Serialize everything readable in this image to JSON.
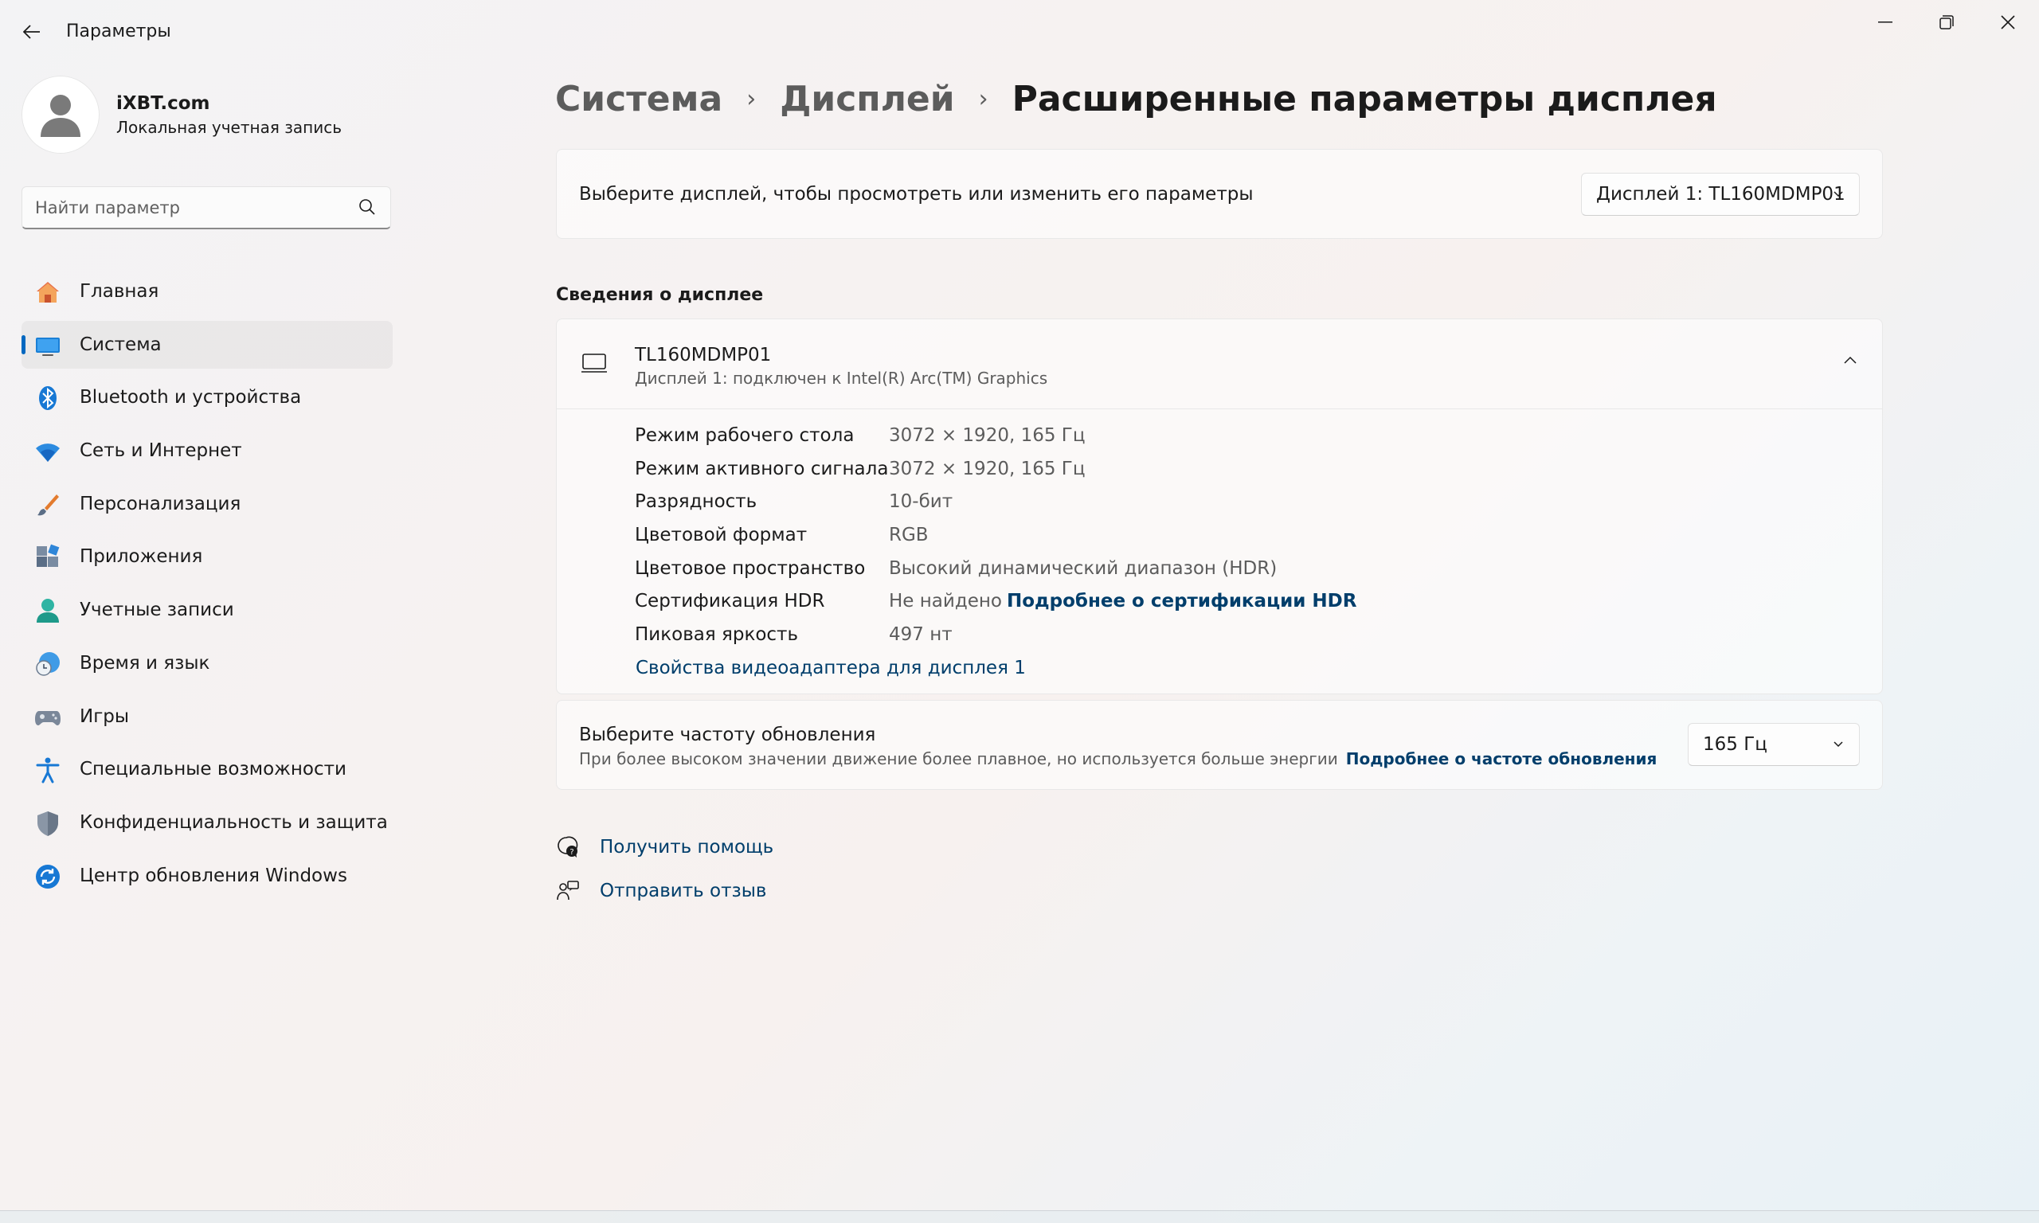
{
  "app": {
    "title": "Параметры"
  },
  "profile": {
    "name": "iXBT.com",
    "subtitle": "Локальная учетная запись"
  },
  "search": {
    "placeholder": "Найти параметр"
  },
  "sidebar": {
    "items": [
      {
        "label": "Главная",
        "icon": "home-icon"
      },
      {
        "label": "Система",
        "icon": "system-icon",
        "active": true
      },
      {
        "label": "Bluetooth и устройства",
        "icon": "bluetooth-icon"
      },
      {
        "label": "Сеть и Интернет",
        "icon": "wifi-icon"
      },
      {
        "label": "Персонализация",
        "icon": "brush-icon"
      },
      {
        "label": "Приложения",
        "icon": "apps-icon"
      },
      {
        "label": "Учетные записи",
        "icon": "accounts-icon"
      },
      {
        "label": "Время и язык",
        "icon": "time-language-icon"
      },
      {
        "label": "Игры",
        "icon": "gamepad-icon"
      },
      {
        "label": "Специальные возможности",
        "icon": "accessibility-icon"
      },
      {
        "label": "Конфиденциальность и защита",
        "icon": "shield-icon"
      },
      {
        "label": "Центр обновления Windows",
        "icon": "windows-update-icon"
      }
    ]
  },
  "breadcrumb": {
    "items": [
      "Система",
      "Дисплей"
    ],
    "current": "Расширенные параметры дисплея"
  },
  "display_select": {
    "label": "Выберите дисплей, чтобы просмотреть или изменить его параметры",
    "value": "Дисплей 1: TL160MDMP01"
  },
  "display_info": {
    "section_title": "Сведения о дисплее",
    "name": "TL160MDMP01",
    "subtitle": "Дисплей 1: подключен к Intel(R) Arc(TM) Graphics",
    "rows": [
      {
        "key": "Режим рабочего стола",
        "value": "3072 × 1920, 165 Гц"
      },
      {
        "key": "Режим активного сигнала",
        "value": "3072 × 1920, 165 Гц"
      },
      {
        "key": "Разрядность",
        "value": "10-бит"
      },
      {
        "key": "Цветовой формат",
        "value": "RGB"
      },
      {
        "key": "Цветовое пространство",
        "value": "Высокий динамический диапазон (HDR)"
      },
      {
        "key": "Сертификация HDR",
        "value": "Не найдено",
        "link": "Подробнее о сертификации HDR"
      },
      {
        "key": "Пиковая яркость",
        "value": "497 нт"
      }
    ],
    "adapter_link": "Свойства видеоадаптера для дисплея 1"
  },
  "refresh_rate": {
    "title": "Выберите частоту обновления",
    "subtitle": "При более высоком значении движение более плавное, но используется больше энергии",
    "link": "Подробнее о частоте обновления",
    "value": "165 Гц"
  },
  "help": {
    "get_help": "Получить помощь",
    "feedback": "Отправить отзыв"
  },
  "colors": {
    "accent": "#0067c0",
    "link": "#003e6b"
  }
}
